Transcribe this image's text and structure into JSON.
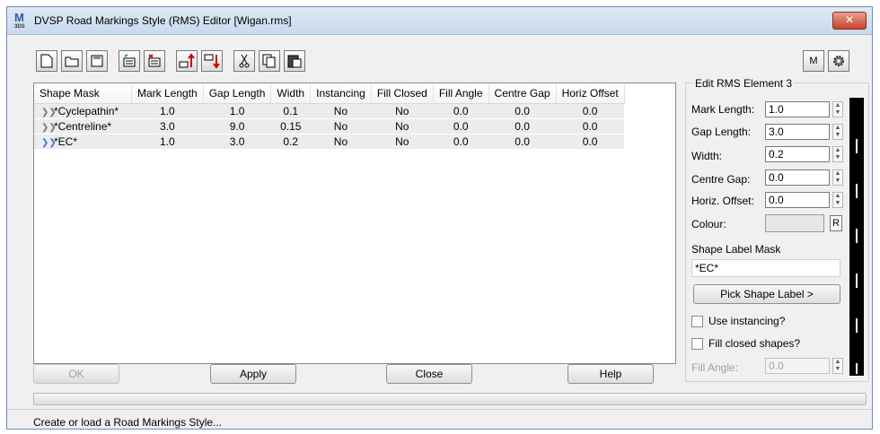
{
  "window": {
    "title": "DVSP Road Markings Style (RMS) Editor [Wigan.rms]",
    "app_icon_letter": "M",
    "app_icon_sub": "3DS",
    "close_glyph": "✕"
  },
  "toolbar": {
    "m_label": "M"
  },
  "grid": {
    "columns": [
      "Shape Mask",
      "Mark Length",
      "Gap Length",
      "Width",
      "Instancing",
      "Fill Closed",
      "Fill Angle",
      "Centre Gap",
      "Horiz Offset"
    ],
    "rows": [
      [
        "*Cyclepathin*",
        "1.0",
        "1.0",
        "0.1",
        "No",
        "No",
        "0.0",
        "0.0",
        "0.0"
      ],
      [
        "*Centreline*",
        "3.0",
        "9.0",
        "0.15",
        "No",
        "No",
        "0.0",
        "0.0",
        "0.0"
      ],
      [
        "*EC*",
        "1.0",
        "3.0",
        "0.2",
        "No",
        "No",
        "0.0",
        "0.0",
        "0.0"
      ]
    ],
    "row_icon_glyph": "❯❯"
  },
  "buttons": {
    "ok": "OK",
    "apply": "Apply",
    "close": "Close",
    "help": "Help"
  },
  "edit_panel": {
    "title": "Edit RMS Element 3",
    "mark_length_label": "Mark Length:",
    "mark_length": "1.0",
    "gap_length_label": "Gap Length:",
    "gap_length": "3.0",
    "width_label": "Width:",
    "width": "0.2",
    "centre_gap_label": "Centre Gap:",
    "centre_gap": "0.0",
    "horiz_offset_label": "Horiz. Offset:",
    "horiz_offset": "0.0",
    "colour_label": "Colour:",
    "colour_reset": "R",
    "shape_label_mask_label": "Shape Label Mask",
    "shape_label_mask": "*EC*",
    "pick_button": "Pick Shape Label >",
    "use_instancing_label": "Use instancing?",
    "fill_closed_label": "Fill closed shapes?",
    "fill_angle_label": "Fill Angle:",
    "fill_angle": "0.0"
  },
  "status": {
    "text": "Create or load a Road Markings Style..."
  }
}
